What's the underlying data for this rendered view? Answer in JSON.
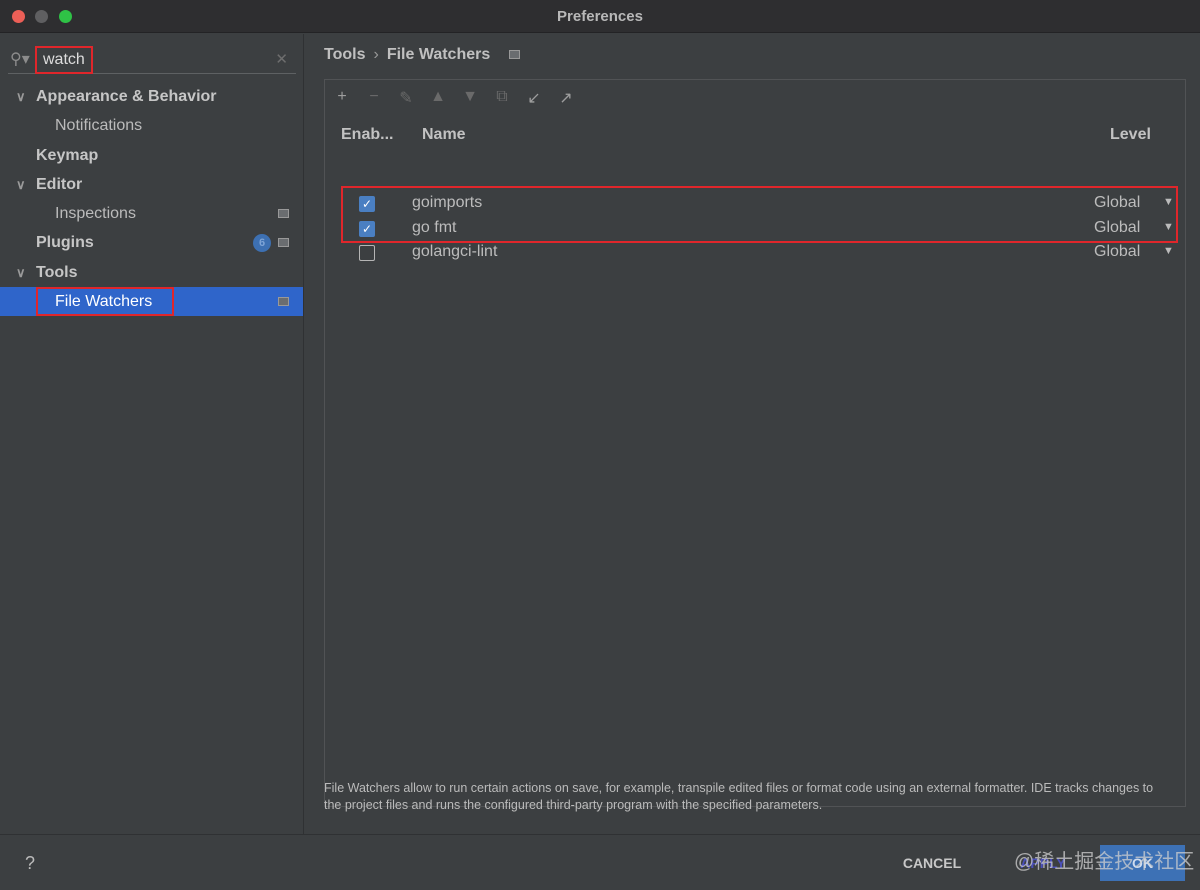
{
  "window": {
    "title": "Preferences"
  },
  "search": {
    "value": "watch"
  },
  "tree": [
    {
      "label": "Appearance & Behavior"
    },
    {
      "label": "Notifications"
    },
    {
      "label": "Keymap"
    },
    {
      "label": "Editor"
    },
    {
      "label": "Inspections"
    },
    {
      "label": "Plugins",
      "badge": "6"
    },
    {
      "label": "Tools"
    },
    {
      "label": "File Watchers"
    }
  ],
  "breadcrumb": {
    "parent": "Tools",
    "current": "File Watchers"
  },
  "table": {
    "headers": {
      "enabled": "Enab...",
      "name": "Name",
      "level": "Level"
    },
    "rows": [
      {
        "enabled": true,
        "name": "goimports",
        "level": "Global"
      },
      {
        "enabled": true,
        "name": "go fmt",
        "level": "Global"
      },
      {
        "enabled": false,
        "name": "golangci-lint",
        "level": "Global"
      }
    ]
  },
  "description": "File Watchers allow to run certain actions on save, for example, transpile edited files or format code using an external formatter. IDE tracks changes to the project files and runs the configured third-party program with the specified parameters.",
  "footer": {
    "help": "?",
    "cancel": "CANCEL",
    "apply": "APPLY",
    "ok": "OK",
    "watermark": "@稀土掘金技术社区"
  }
}
